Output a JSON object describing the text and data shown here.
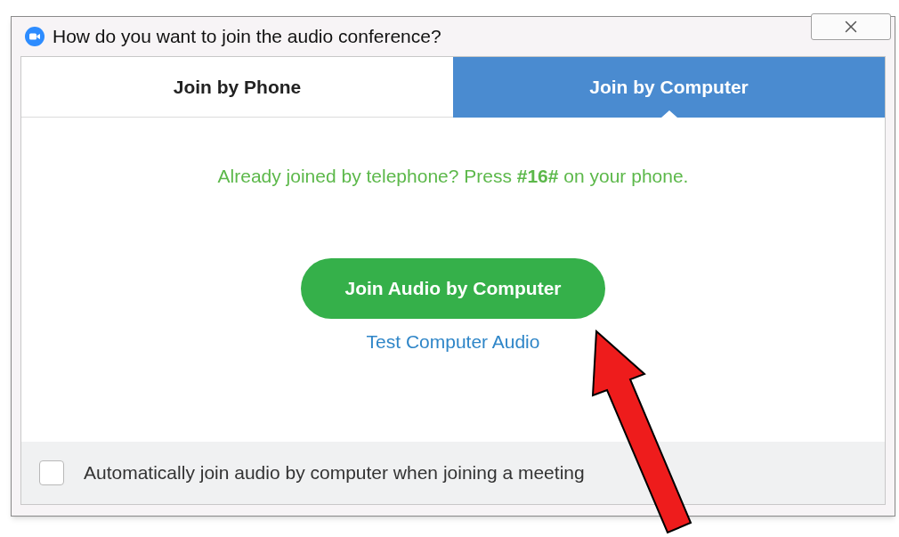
{
  "window": {
    "title": "How do you want to join the audio conference?"
  },
  "tabs": [
    {
      "label": "Join by Phone",
      "selected": false
    },
    {
      "label": "Join by Computer",
      "selected": true
    }
  ],
  "message": "Already joined by telephone? Press **#16#** on your phone.",
  "primary_button": "Join Audio by Computer",
  "link": "Test Computer Audio",
  "auto_join": {
    "label": "Automatically join audio by computer when joining a meeting",
    "checked": false
  }
}
